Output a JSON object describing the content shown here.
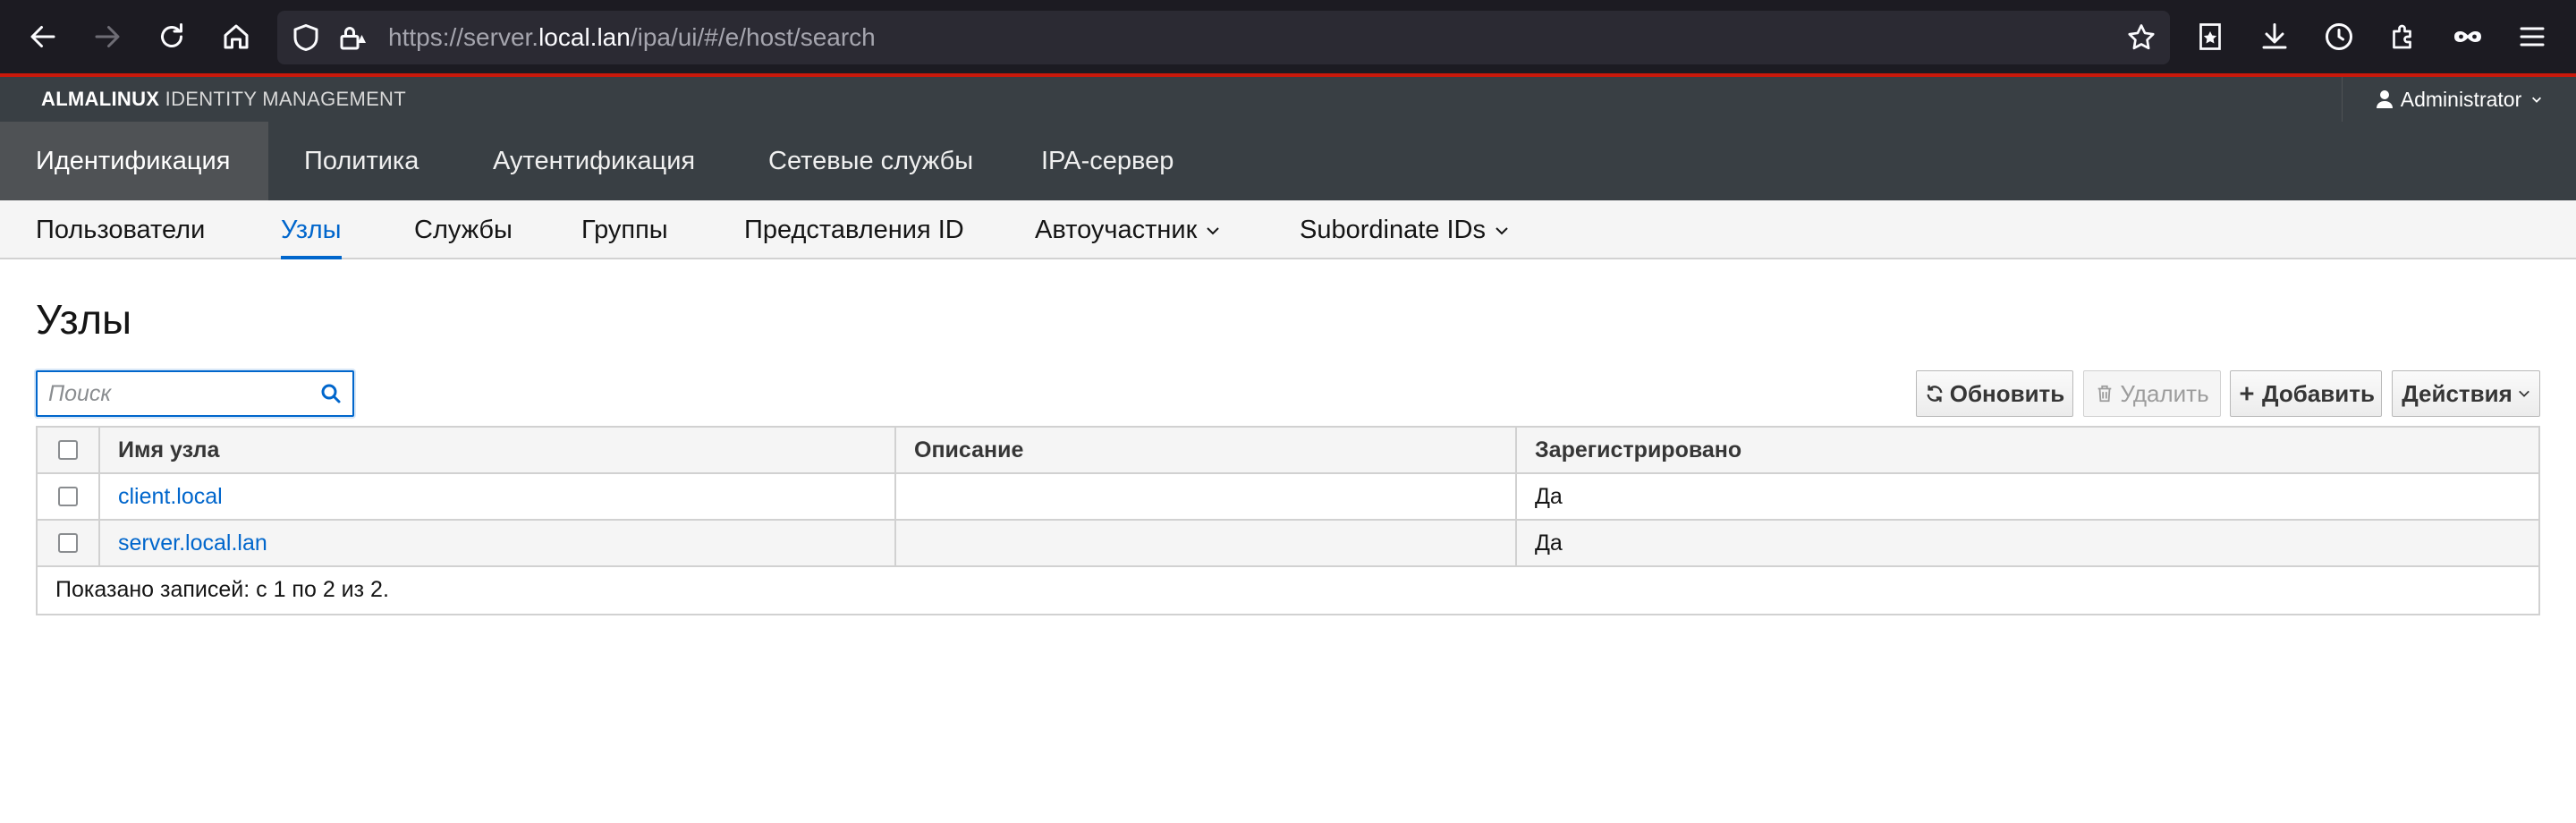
{
  "browser": {
    "url_prefix": "https://server.",
    "url_host": "local.lan",
    "url_path": "/ipa/ui/#/e/host/search"
  },
  "masthead": {
    "brand_bold": "ALMALINUX",
    "brand_rest": " IDENTITY MANAGEMENT",
    "user_label": "Administrator"
  },
  "primary_nav": [
    {
      "label": "Идентификация"
    },
    {
      "label": "Политика"
    },
    {
      "label": "Аутентификация"
    },
    {
      "label": "Сетевые службы"
    },
    {
      "label": "IPA-сервер"
    }
  ],
  "secondary_nav": [
    {
      "label": "Пользователи"
    },
    {
      "label": "Узлы"
    },
    {
      "label": "Службы"
    },
    {
      "label": "Группы"
    },
    {
      "label": "Представления ID"
    },
    {
      "label": "Автоучастник"
    },
    {
      "label": "Subordinate IDs"
    }
  ],
  "page": {
    "title": "Узлы",
    "search_placeholder": "Поиск"
  },
  "toolbar": {
    "refresh_label": "Обновить",
    "delete_label": "Удалить",
    "add_label": "Добавить",
    "actions_label": "Действия"
  },
  "table": {
    "columns": [
      "Имя узла",
      "Описание",
      "Зарегистрировано"
    ],
    "rows": [
      {
        "name": "client.local",
        "description": "",
        "enrolled": "Да"
      },
      {
        "name": "server.local.lan",
        "description": "",
        "enrolled": "Да"
      }
    ],
    "footer": "Показано записей: с 1 по 2 из 2."
  },
  "colors": {
    "accent": "#0066cc",
    "masthead": "#393f44",
    "brand_line": "#c9190b"
  }
}
